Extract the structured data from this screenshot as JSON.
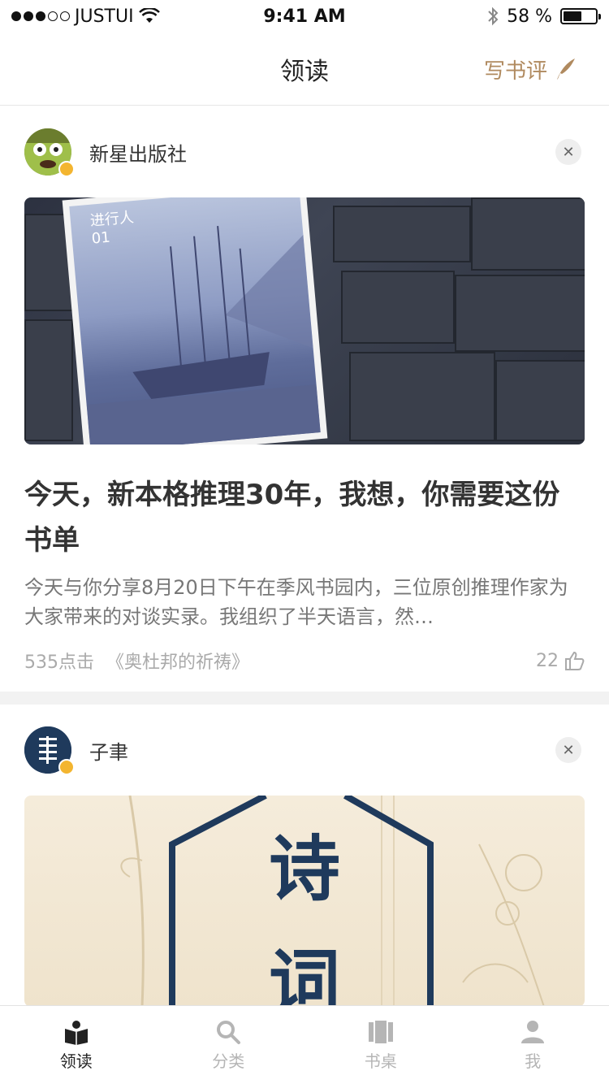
{
  "status_bar": {
    "carrier": "JUSTUI",
    "time": "9:41 AM",
    "battery_text": "58 %",
    "battery_level": 0.58
  },
  "nav": {
    "title": "领读",
    "action_label": "写书评"
  },
  "cards": [
    {
      "author": "新星出版社",
      "book_cover_text": "进行人",
      "book_cover_number": "01",
      "headline": "今天，新本格推理30年，我想，你需要这份书单",
      "excerpt": "今天与你分享8月20日下午在季风书园内，三位原创推理作家为大家带来的对谈实录。我组织了半天语言，然…",
      "clicks": "535点击",
      "book": "《奥杜邦的祈祷》",
      "likes": "22"
    },
    {
      "author": "子聿",
      "cover_text_1": "诗",
      "cover_text_2": "词"
    }
  ],
  "tabs": [
    {
      "label": "领读",
      "icon": "book-icon",
      "active": true
    },
    {
      "label": "分类",
      "icon": "search-icon",
      "active": false
    },
    {
      "label": "书桌",
      "icon": "bookshelf-icon",
      "active": false
    },
    {
      "label": "我",
      "icon": "person-icon",
      "active": false
    }
  ],
  "colors": {
    "accent": "#b08a5f",
    "verified": "#f3b530",
    "navy": "#1f3a5c"
  }
}
